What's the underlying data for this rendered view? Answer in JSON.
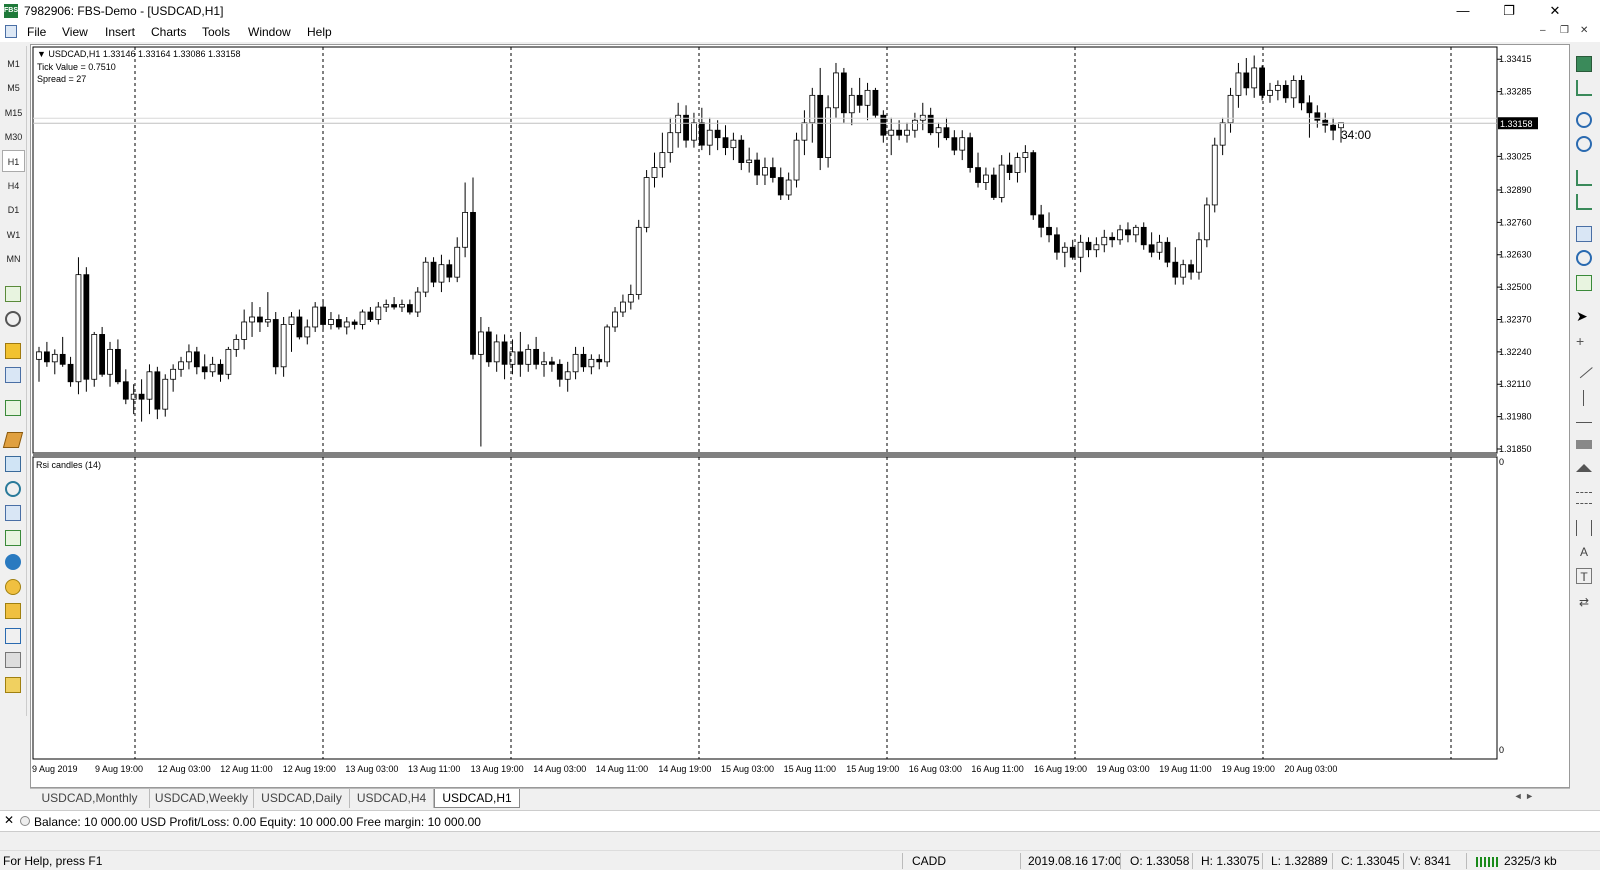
{
  "window": {
    "title": "7982906: FBS-Demo - [USDCAD,H1]",
    "app_icon_text": "FBS",
    "minimize": "—",
    "restore": "❐",
    "close": "✕"
  },
  "menu": {
    "items": [
      "File",
      "View",
      "Insert",
      "Charts",
      "Tools",
      "Window",
      "Help"
    ],
    "mdi_minimize": "–",
    "mdi_restore": "❐",
    "mdi_close": "✕"
  },
  "timeframes": [
    "M1",
    "M5",
    "M15",
    "M30",
    "H1",
    "H4",
    "D1",
    "W1",
    "MN"
  ],
  "active_timeframe": "H1",
  "chart": {
    "info_line1": "▼ USDCAD,H1  1.33146  1.33164 1.33086 1.33158",
    "info_line2": "Tick Value = 0.7510",
    "info_line3": "Spread = 27",
    "rsi_label": "Rsi candles (14)",
    "countdown": "34:00",
    "current_price": "1.33158",
    "colors": {
      "bull_fill": "#ffffff",
      "bear_fill": "#000000",
      "wick": "#000000",
      "background": "#ffffff",
      "grid": "#000000",
      "price_marker_bg": "#000000",
      "price_marker_text": "#ffffff"
    }
  },
  "chart_data": {
    "type": "candlestick",
    "symbol": "USDCAD",
    "timeframe": "H1",
    "y_ticks": [
      "1.33415",
      "1.33285",
      "1.33025",
      "1.32890",
      "1.32760",
      "1.32630",
      "1.32500",
      "1.32370",
      "1.32240",
      "1.32110",
      "1.31980",
      "1.31850"
    ],
    "ylim": [
      1.3185,
      1.3344
    ],
    "x_ticks": [
      "9 Aug 2019",
      "9 Aug 19:00",
      "12 Aug 03:00",
      "12 Aug 11:00",
      "12 Aug 19:00",
      "13 Aug 03:00",
      "13 Aug 11:00",
      "13 Aug 19:00",
      "14 Aug 03:00",
      "14 Aug 11:00",
      "14 Aug 19:00",
      "15 Aug 03:00",
      "15 Aug 11:00",
      "15 Aug 19:00",
      "16 Aug 03:00",
      "16 Aug 11:00",
      "16 Aug 19:00",
      "19 Aug 03:00",
      "19 Aug 11:00",
      "19 Aug 19:00",
      "20 Aug 03:00"
    ],
    "rsi_ylim": [
      0,
      100
    ],
    "rsi_ticks": [
      "0",
      "0"
    ],
    "candles": [
      [
        1.3221,
        1.3226,
        1.3212,
        1.3224
      ],
      [
        1.3224,
        1.3228,
        1.3218,
        1.322
      ],
      [
        1.322,
        1.3225,
        1.3215,
        1.3223
      ],
      [
        1.3223,
        1.323,
        1.3218,
        1.3219
      ],
      [
        1.3219,
        1.3222,
        1.321,
        1.3212
      ],
      [
        1.3212,
        1.3262,
        1.3207,
        1.3255
      ],
      [
        1.3255,
        1.3258,
        1.3208,
        1.3213
      ],
      [
        1.3213,
        1.3232,
        1.321,
        1.3231
      ],
      [
        1.3231,
        1.3234,
        1.3214,
        1.3215
      ],
      [
        1.3215,
        1.3228,
        1.321,
        1.3225
      ],
      [
        1.3225,
        1.3229,
        1.3211,
        1.3212
      ],
      [
        1.3212,
        1.3217,
        1.3203,
        1.3205
      ],
      [
        1.3205,
        1.3211,
        1.3199,
        1.3207
      ],
      [
        1.3207,
        1.3213,
        1.3196,
        1.3205
      ],
      [
        1.3205,
        1.3219,
        1.3199,
        1.3216
      ],
      [
        1.3216,
        1.3218,
        1.3197,
        1.3201
      ],
      [
        1.3201,
        1.3215,
        1.3198,
        1.3213
      ],
      [
        1.3213,
        1.3219,
        1.3208,
        1.3217
      ],
      [
        1.3217,
        1.3222,
        1.3214,
        1.322
      ],
      [
        1.322,
        1.3227,
        1.3217,
        1.3224
      ],
      [
        1.3224,
        1.3226,
        1.3215,
        1.3218
      ],
      [
        1.3218,
        1.3223,
        1.3213,
        1.3216
      ],
      [
        1.3216,
        1.3222,
        1.3214,
        1.3219
      ],
      [
        1.3219,
        1.3221,
        1.3212,
        1.3215
      ],
      [
        1.3215,
        1.3226,
        1.3213,
        1.3225
      ],
      [
        1.3225,
        1.3231,
        1.3222,
        1.3229
      ],
      [
        1.3229,
        1.3241,
        1.3225,
        1.3236
      ],
      [
        1.3236,
        1.3244,
        1.323,
        1.3238
      ],
      [
        1.3238,
        1.3242,
        1.3232,
        1.3236
      ],
      [
        1.3236,
        1.3248,
        1.3234,
        1.3237
      ],
      [
        1.3237,
        1.324,
        1.3215,
        1.3218
      ],
      [
        1.3218,
        1.3238,
        1.3214,
        1.3235
      ],
      [
        1.3235,
        1.324,
        1.3224,
        1.3238
      ],
      [
        1.3238,
        1.3241,
        1.3229,
        1.323
      ],
      [
        1.323,
        1.3237,
        1.3227,
        1.3234
      ],
      [
        1.3234,
        1.3244,
        1.3232,
        1.3242
      ],
      [
        1.3242,
        1.3245,
        1.3233,
        1.3235
      ],
      [
        1.3235,
        1.324,
        1.3233,
        1.3237
      ],
      [
        1.3237,
        1.3239,
        1.3233,
        1.3234
      ],
      [
        1.3234,
        1.3238,
        1.3231,
        1.3236
      ],
      [
        1.3236,
        1.3237,
        1.3233,
        1.3235
      ],
      [
        1.3235,
        1.3241,
        1.3233,
        1.324
      ],
      [
        1.324,
        1.3242,
        1.3236,
        1.3237
      ],
      [
        1.3237,
        1.3244,
        1.3235,
        1.3242
      ],
      [
        1.3242,
        1.3245,
        1.324,
        1.3243
      ],
      [
        1.3243,
        1.3246,
        1.3241,
        1.3242
      ],
      [
        1.3242,
        1.3245,
        1.324,
        1.3243
      ],
      [
        1.3243,
        1.3245,
        1.3239,
        1.324
      ],
      [
        1.324,
        1.325,
        1.3238,
        1.3248
      ],
      [
        1.3248,
        1.3262,
        1.3246,
        1.326
      ],
      [
        1.326,
        1.3262,
        1.325,
        1.3252
      ],
      [
        1.3252,
        1.3263,
        1.3248,
        1.3259
      ],
      [
        1.3259,
        1.3261,
        1.3252,
        1.3254
      ],
      [
        1.3254,
        1.327,
        1.3252,
        1.3266
      ],
      [
        1.3266,
        1.3292,
        1.3262,
        1.328
      ],
      [
        1.328,
        1.3294,
        1.3221,
        1.3223
      ],
      [
        1.3223,
        1.3238,
        1.3186,
        1.3232
      ],
      [
        1.3232,
        1.3234,
        1.3218,
        1.322
      ],
      [
        1.322,
        1.3231,
        1.3216,
        1.3228
      ],
      [
        1.3228,
        1.3231,
        1.3213,
        1.3219
      ],
      [
        1.3219,
        1.3229,
        1.3215,
        1.3224
      ],
      [
        1.3224,
        1.3232,
        1.3214,
        1.3219
      ],
      [
        1.3219,
        1.3227,
        1.3216,
        1.3225
      ],
      [
        1.3225,
        1.323,
        1.3217,
        1.3219
      ],
      [
        1.3219,
        1.3224,
        1.3214,
        1.322
      ],
      [
        1.322,
        1.3222,
        1.3216,
        1.3219
      ],
      [
        1.3219,
        1.3221,
        1.321,
        1.3213
      ],
      [
        1.3213,
        1.322,
        1.3208,
        1.3216
      ],
      [
        1.3216,
        1.3226,
        1.3213,
        1.3223
      ],
      [
        1.3223,
        1.3226,
        1.3216,
        1.3218
      ],
      [
        1.3218,
        1.3223,
        1.3215,
        1.3221
      ],
      [
        1.3221,
        1.3223,
        1.3217,
        1.322
      ],
      [
        1.322,
        1.3235,
        1.3218,
        1.3234
      ],
      [
        1.3234,
        1.3242,
        1.3232,
        1.324
      ],
      [
        1.324,
        1.3247,
        1.3238,
        1.3244
      ],
      [
        1.3244,
        1.3251,
        1.3241,
        1.3247
      ],
      [
        1.3247,
        1.3277,
        1.3245,
        1.3274
      ],
      [
        1.3274,
        1.3297,
        1.3272,
        1.3294
      ],
      [
        1.3294,
        1.3304,
        1.329,
        1.3298
      ],
      [
        1.3298,
        1.3312,
        1.3294,
        1.3304
      ],
      [
        1.3304,
        1.3318,
        1.33,
        1.3312
      ],
      [
        1.3312,
        1.3324,
        1.3306,
        1.3319
      ],
      [
        1.3319,
        1.3323,
        1.3306,
        1.3309
      ],
      [
        1.3309,
        1.332,
        1.3306,
        1.3316
      ],
      [
        1.3316,
        1.3322,
        1.3305,
        1.3307
      ],
      [
        1.3307,
        1.3318,
        1.3303,
        1.3313
      ],
      [
        1.3313,
        1.3317,
        1.3305,
        1.331
      ],
      [
        1.331,
        1.3315,
        1.3303,
        1.3306
      ],
      [
        1.3306,
        1.3312,
        1.3301,
        1.3309
      ],
      [
        1.3309,
        1.3311,
        1.3297,
        1.33
      ],
      [
        1.33,
        1.3306,
        1.3296,
        1.3301
      ],
      [
        1.3301,
        1.3304,
        1.3291,
        1.3295
      ],
      [
        1.3295,
        1.3302,
        1.3291,
        1.3298
      ],
      [
        1.3298,
        1.3302,
        1.3292,
        1.3294
      ],
      [
        1.3294,
        1.3298,
        1.3285,
        1.3287
      ],
      [
        1.3287,
        1.3296,
        1.3285,
        1.3293
      ],
      [
        1.3293,
        1.3312,
        1.329,
        1.3309
      ],
      [
        1.3309,
        1.3321,
        1.3303,
        1.3316
      ],
      [
        1.3316,
        1.333,
        1.3308,
        1.3327
      ],
      [
        1.3327,
        1.3338,
        1.3297,
        1.3302
      ],
      [
        1.3302,
        1.3327,
        1.3298,
        1.3322
      ],
      [
        1.3322,
        1.334,
        1.3318,
        1.3336
      ],
      [
        1.3336,
        1.3338,
        1.3316,
        1.332
      ],
      [
        1.332,
        1.333,
        1.3315,
        1.3327
      ],
      [
        1.3327,
        1.3334,
        1.332,
        1.3323
      ],
      [
        1.3323,
        1.3332,
        1.3317,
        1.3329
      ],
      [
        1.3329,
        1.333,
        1.3318,
        1.3319
      ],
      [
        1.3319,
        1.3321,
        1.3308,
        1.3311
      ],
      [
        1.3311,
        1.3318,
        1.3303,
        1.3313
      ],
      [
        1.3313,
        1.3317,
        1.3309,
        1.3311
      ],
      [
        1.3311,
        1.3316,
        1.3308,
        1.3313
      ],
      [
        1.3313,
        1.332,
        1.331,
        1.3317
      ],
      [
        1.3317,
        1.3324,
        1.3313,
        1.3319
      ],
      [
        1.3319,
        1.3322,
        1.3311,
        1.3312
      ],
      [
        1.3312,
        1.3316,
        1.3306,
        1.3314
      ],
      [
        1.3314,
        1.3318,
        1.3309,
        1.331
      ],
      [
        1.331,
        1.3313,
        1.3303,
        1.3305
      ],
      [
        1.3305,
        1.3313,
        1.3301,
        1.331
      ],
      [
        1.331,
        1.3312,
        1.3296,
        1.3298
      ],
      [
        1.3298,
        1.3304,
        1.329,
        1.3292
      ],
      [
        1.3292,
        1.3298,
        1.3289,
        1.3295
      ],
      [
        1.3295,
        1.3298,
        1.3285,
        1.3286
      ],
      [
        1.3286,
        1.3303,
        1.3284,
        1.3299
      ],
      [
        1.3299,
        1.3304,
        1.3293,
        1.3296
      ],
      [
        1.3296,
        1.3304,
        1.3292,
        1.3302
      ],
      [
        1.3302,
        1.3307,
        1.3296,
        1.3304
      ],
      [
        1.3304,
        1.3305,
        1.3277,
        1.3279
      ],
      [
        1.3279,
        1.3283,
        1.327,
        1.3274
      ],
      [
        1.3274,
        1.328,
        1.3268,
        1.3271
      ],
      [
        1.3271,
        1.3274,
        1.3261,
        1.3264
      ],
      [
        1.3264,
        1.3268,
        1.3258,
        1.3266
      ],
      [
        1.3266,
        1.3269,
        1.3261,
        1.3262
      ],
      [
        1.3262,
        1.3271,
        1.3256,
        1.3268
      ],
      [
        1.3268,
        1.327,
        1.3262,
        1.3265
      ],
      [
        1.3265,
        1.327,
        1.3262,
        1.3267
      ],
      [
        1.3267,
        1.3273,
        1.3264,
        1.327
      ],
      [
        1.327,
        1.3272,
        1.3266,
        1.3269
      ],
      [
        1.3269,
        1.3275,
        1.3267,
        1.3273
      ],
      [
        1.3273,
        1.3276,
        1.3268,
        1.3271
      ],
      [
        1.3271,
        1.3275,
        1.3268,
        1.3274
      ],
      [
        1.3274,
        1.3276,
        1.3265,
        1.3267
      ],
      [
        1.3267,
        1.3272,
        1.3262,
        1.3264
      ],
      [
        1.3264,
        1.3271,
        1.3261,
        1.3268
      ],
      [
        1.3268,
        1.327,
        1.3258,
        1.326
      ],
      [
        1.326,
        1.3266,
        1.3251,
        1.3254
      ],
      [
        1.3254,
        1.3261,
        1.3251,
        1.3259
      ],
      [
        1.3259,
        1.3261,
        1.3253,
        1.3256
      ],
      [
        1.3256,
        1.3272,
        1.3253,
        1.3269
      ],
      [
        1.3269,
        1.3286,
        1.3266,
        1.3283
      ],
      [
        1.3283,
        1.331,
        1.328,
        1.3307
      ],
      [
        1.3307,
        1.3318,
        1.3303,
        1.3316
      ],
      [
        1.3316,
        1.333,
        1.3312,
        1.3327
      ],
      [
        1.3327,
        1.334,
        1.3322,
        1.3336
      ],
      [
        1.3336,
        1.3342,
        1.3327,
        1.333
      ],
      [
        1.333,
        1.3343,
        1.3326,
        1.3338
      ],
      [
        1.3338,
        1.3339,
        1.3325,
        1.3327
      ],
      [
        1.3327,
        1.3332,
        1.3324,
        1.3329
      ],
      [
        1.3329,
        1.3333,
        1.3325,
        1.3331
      ],
      [
        1.3331,
        1.3333,
        1.3324,
        1.3326
      ],
      [
        1.3326,
        1.3335,
        1.3322,
        1.3333
      ],
      [
        1.3333,
        1.3335,
        1.3321,
        1.3324
      ],
      [
        1.3324,
        1.3327,
        1.331,
        1.332
      ],
      [
        1.332,
        1.3323,
        1.3314,
        1.3317
      ],
      [
        1.3317,
        1.332,
        1.3312,
        1.3315
      ],
      [
        1.3315,
        1.3318,
        1.3309,
        1.3313
      ],
      [
        1.3314,
        1.3316,
        1.3308,
        1.3316
      ]
    ]
  },
  "tabs": [
    "USDCAD,Monthly",
    "USDCAD,Weekly",
    "USDCAD,Daily",
    "USDCAD,H4",
    "USDCAD,H1"
  ],
  "active_tab": "USDCAD,H1",
  "tabs_scroll": "◄  ►",
  "terminal": {
    "close": "✕",
    "balance_line": "Balance: 10 000.00 USD  Profit/Loss: 0.00  Equity: 10 000.00  Free margin: 10 000.00"
  },
  "statusbar": {
    "help": "For Help, press F1",
    "profile": "CADD",
    "datetime": "2019.08.16 17:00",
    "open": "O: 1.33058",
    "high": "H: 1.33075",
    "low": "L: 1.32889",
    "close": "C: 1.33045",
    "volume": "V: 8341",
    "traffic": "2325/3 kb"
  }
}
